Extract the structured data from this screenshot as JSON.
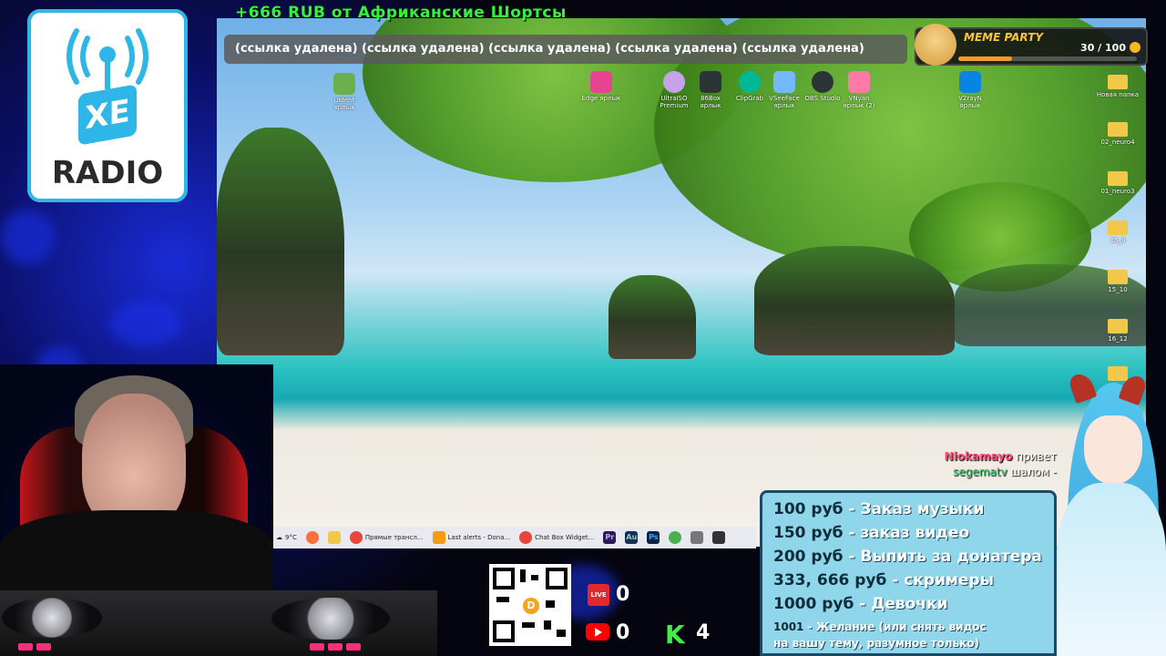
{
  "logo": {
    "top_text": "XE",
    "bottom_text": "RADIO"
  },
  "alert": {
    "marquee": "+666 RUB  от Африканские Шортсы"
  },
  "banner": {
    "text": "(ссылка удалена) (ссылка удалена) (ссылка удалена) (ссылка удалена) (ссылка удалена)"
  },
  "desktop_icons": [
    {
      "label": "uIdent ярлык",
      "icon": "app-icon",
      "color": "#6ab04c"
    },
    {
      "label": "Edge ярлык",
      "icon": "app-icon",
      "color": "#e84393"
    },
    {
      "label": "UltraISO Premium",
      "icon": "disc-icon",
      "color": "#c8a2e8"
    },
    {
      "label": "86Box ярлык",
      "icon": "app-icon",
      "color": "#2d3436"
    },
    {
      "label": "ClipGrab",
      "icon": "app-icon",
      "color": "#00b894"
    },
    {
      "label": "VSeeFace ярлык",
      "icon": "app-icon",
      "color": "#74b9ff"
    },
    {
      "label": "OBS Studio",
      "icon": "obs-icon",
      "color": "#2d3436"
    },
    {
      "label": "VNyan ярлык (2)",
      "icon": "cat-icon",
      "color": "#fd79a8"
    },
    {
      "label": "V2rayN ярлык",
      "icon": "app-icon",
      "color": "#0984e3"
    }
  ],
  "folders": [
    {
      "label": "Новая папка"
    },
    {
      "label": "02_neuro4"
    },
    {
      "label": "01_neuro3"
    },
    {
      "label": "16_9"
    },
    {
      "label": "15_10"
    },
    {
      "label": "16_12"
    }
  ],
  "meme_party": {
    "title": "MEME PARTY",
    "count": "30 / 100",
    "progress": 0.3
  },
  "taskbar": {
    "weather": "9°C",
    "items": [
      {
        "label": "Прямые трансл...",
        "icon": "chrome-icon",
        "color": "#e8453c"
      },
      {
        "label": "Last alerts - Dona...",
        "icon": "donation-icon",
        "color": "#f39c12"
      },
      {
        "label": "Chat Box Widget...",
        "icon": "chrome-icon",
        "color": "#e8453c"
      }
    ],
    "apps": [
      {
        "label": "Pr",
        "color": "#2b1a55"
      },
      {
        "label": "Au",
        "color": "#1b2c55"
      },
      {
        "label": "Ps",
        "color": "#0a2342"
      }
    ]
  },
  "counters": {
    "live": "0",
    "live_label": "LIVE",
    "youtube": "0",
    "kick": "4",
    "kick_letter": "K"
  },
  "qr": {
    "coin_letter": "D"
  },
  "donations": [
    {
      "price": "100 руб",
      "desc": " - Заказ музыки"
    },
    {
      "price": "150 руб",
      "desc": " - заказ видео"
    },
    {
      "price": "200 руб",
      "desc": " - Выпить за донатера"
    },
    {
      "price": "333, 666 руб",
      "desc": " - скримеры"
    },
    {
      "price": "1000 руб",
      "desc": " - Девочки"
    }
  ],
  "donation_small": {
    "price": "1001",
    "line1": " - Желание (или снять видос",
    "line2": "на вашу тему, разумное только)"
  },
  "chat": [
    {
      "user": "Niokamayo",
      "text": "привет",
      "color": "#ff4d7a"
    },
    {
      "user": "segematv",
      "text": "шалом",
      "color": "#3cd070"
    }
  ],
  "colors": {
    "green_text": "#37f23a",
    "donation_bg": "#8fd6ea",
    "accent": "#2fb6e8"
  }
}
